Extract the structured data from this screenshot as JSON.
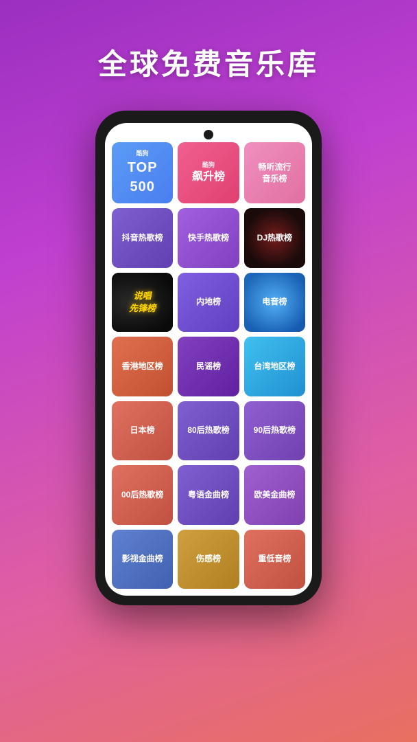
{
  "page": {
    "title": "全球免费音乐库",
    "background_gradient": [
      "#9b2fc0",
      "#c040d0",
      "#e060a0",
      "#e87060"
    ]
  },
  "music_cards": [
    {
      "id": "top500",
      "label_small": "酷狗",
      "label_big": "TOP 500",
      "style_class": "card-top500"
    },
    {
      "id": "feiyang",
      "label": "酷狗\n飙升榜",
      "style_class": "card-feiyang"
    },
    {
      "id": "liuxing",
      "label": "畅听流行\n音乐榜",
      "style_class": "card-liuxing"
    },
    {
      "id": "douyin",
      "label": "抖音热歌榜",
      "style_class": "card-douyin"
    },
    {
      "id": "kuaishou",
      "label": "快手热歌榜",
      "style_class": "card-kuaishou"
    },
    {
      "id": "dj",
      "label": "DJ热歌榜",
      "style_class": "card-dj"
    },
    {
      "id": "shuochang",
      "label": "说唱先锋榜",
      "style_class": "card-shuochang"
    },
    {
      "id": "neidi",
      "label": "内地榜",
      "style_class": "card-neidi"
    },
    {
      "id": "diyin",
      "label": "电音榜",
      "style_class": "card-diyin"
    },
    {
      "id": "xianggang",
      "label": "香港地区榜",
      "style_class": "card-xianggang"
    },
    {
      "id": "minyao",
      "label": "民谣榜",
      "style_class": "card-minyao"
    },
    {
      "id": "taiwan",
      "label": "台湾地区榜",
      "style_class": "card-taiwan"
    },
    {
      "id": "riben",
      "label": "日本榜",
      "style_class": "card-riben"
    },
    {
      "id": "80hou",
      "label": "80后热歌榜",
      "style_class": "card-80hou"
    },
    {
      "id": "90hou",
      "label": "90后热歌榜",
      "style_class": "card-90hou"
    },
    {
      "id": "00hou",
      "label": "00后热歌榜",
      "style_class": "card-00hou"
    },
    {
      "id": "yueyu",
      "label": "粤语金曲榜",
      "style_class": "card-yueyu"
    },
    {
      "id": "oumei",
      "label": "欧美金曲榜",
      "style_class": "card-oumei"
    },
    {
      "id": "yingshi",
      "label": "影视金曲榜",
      "style_class": "card-yingshi"
    },
    {
      "id": "shanggan",
      "label": "伤感榜",
      "style_class": "card-shanggan"
    },
    {
      "id": "zhongdiyin",
      "label": "重低音榜",
      "style_class": "card-zhongdiyin"
    }
  ]
}
